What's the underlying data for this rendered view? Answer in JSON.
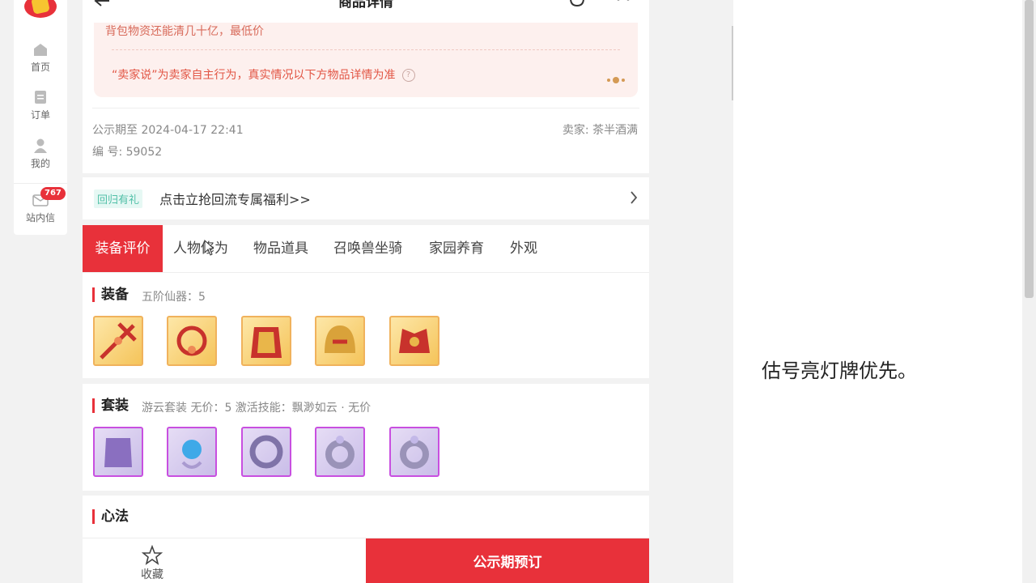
{
  "sidebar": {
    "items": [
      {
        "label": "首页",
        "icon": "home-icon"
      },
      {
        "label": "订单",
        "icon": "order-icon"
      },
      {
        "label": "我的",
        "icon": "user-icon"
      },
      {
        "label": "站内信",
        "icon": "mail-icon",
        "badge": "767"
      }
    ]
  },
  "header": {
    "title": "商品详情"
  },
  "seller_notice": {
    "line1": "背包物资还能清几十亿，最低价",
    "line2": "“卖家说”为卖家自主行为，真实情况以下方物品详情为准",
    "help_icon": "?"
  },
  "meta": {
    "publicity": "公示期至 2024-04-17 22:41",
    "id_line": "编 号: 59052",
    "seller": "卖家: 茶半酒满"
  },
  "promo": {
    "tag": "回归有礼",
    "text": "点击立抢回流专属福利>>"
  },
  "tabs": [
    "装备评价",
    "人物修为",
    "物品道具",
    "召唤兽坐骑",
    "家园养育",
    "外观"
  ],
  "equipment": {
    "title": "装备",
    "sub": "五阶仙器：5"
  },
  "suit": {
    "title": "套装",
    "sub": "游云套装   无价：5   激活技能：飘渺如云 · 无价"
  },
  "heart": {
    "title": "心法"
  },
  "bottom": {
    "fav_label": "收藏",
    "buy_label": "公示期预订"
  },
  "side_note": "估号亮灯牌优先。",
  "colors": {
    "accent": "#e8313a",
    "notice_bg": "#fdf0ee",
    "gold_frame": "#f0b25c",
    "purple_frame": "#c84fe0"
  }
}
